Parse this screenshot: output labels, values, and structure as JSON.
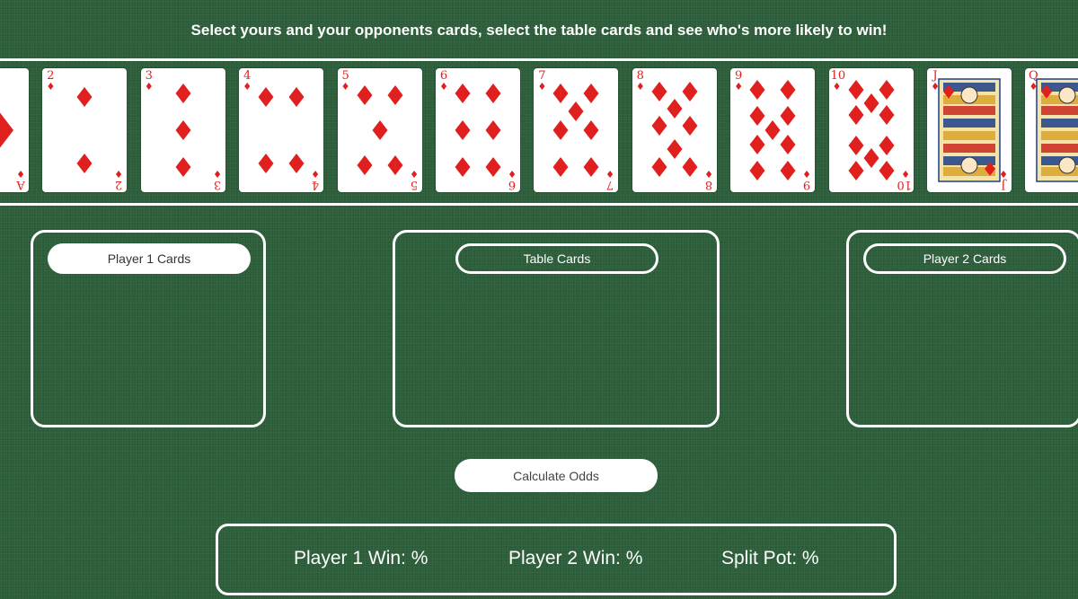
{
  "instructions": "Select yours and your opponents cards, select the table cards and see who's more likely to win!",
  "colors": {
    "felt": "#2c5e3a",
    "card_red": "#e0201e",
    "line": "#ffffff"
  },
  "suit_icon": "diamond-icon",
  "deck": [
    {
      "rank": "A",
      "suit": "♦"
    },
    {
      "rank": "2",
      "suit": "♦"
    },
    {
      "rank": "3",
      "suit": "♦"
    },
    {
      "rank": "4",
      "suit": "♦"
    },
    {
      "rank": "5",
      "suit": "♦"
    },
    {
      "rank": "6",
      "suit": "♦"
    },
    {
      "rank": "7",
      "suit": "♦"
    },
    {
      "rank": "8",
      "suit": "♦"
    },
    {
      "rank": "9",
      "suit": "♦"
    },
    {
      "rank": "10",
      "suit": "♦"
    },
    {
      "rank": "J",
      "suit": "♦"
    },
    {
      "rank": "Q",
      "suit": "♦"
    }
  ],
  "panels": {
    "player1": {
      "label": "Player 1 Cards"
    },
    "table": {
      "label": "Table Cards"
    },
    "player2": {
      "label": "Player 2 Cards"
    }
  },
  "calculate_label": "Calculate Odds",
  "results": {
    "player1": "Player 1 Win: %",
    "player2": "Player 2 Win: %",
    "split": "Split Pot: %"
  }
}
